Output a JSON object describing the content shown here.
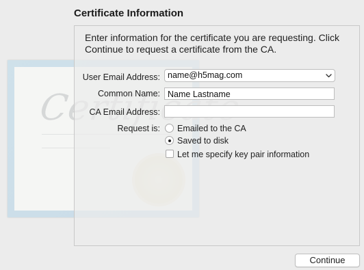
{
  "page": {
    "title": "Certificate Information",
    "intro": "Enter information for the certificate you are requesting. Click Continue to request a certificate from the CA."
  },
  "background_art": {
    "script_text": "Certificate"
  },
  "form": {
    "user_email": {
      "label": "User Email Address:",
      "value": "name@h5mag.com"
    },
    "common_name": {
      "label": "Common Name:",
      "value": "Name Lastname"
    },
    "ca_email": {
      "label": "CA Email Address:",
      "value": ""
    },
    "request_is": {
      "label": "Request is:",
      "options": [
        {
          "label": "Emailed to the CA",
          "checked": false
        },
        {
          "label": "Saved to disk",
          "checked": true
        }
      ]
    },
    "key_pair": {
      "label": "Let me specify key pair information",
      "checked": false
    }
  },
  "buttons": {
    "continue_label": "Continue"
  },
  "icons": {
    "popup_indicator": "chevron-down-icon"
  }
}
